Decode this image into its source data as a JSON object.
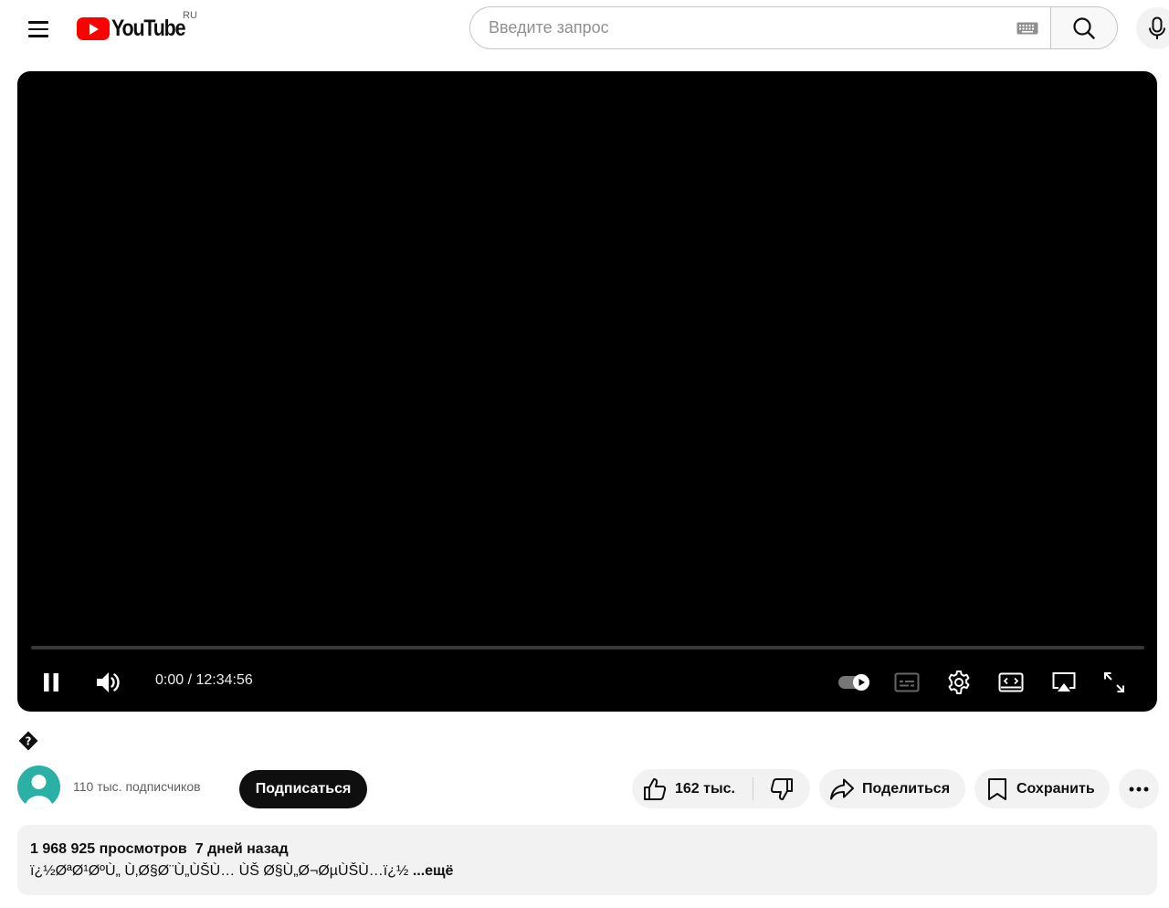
{
  "header": {
    "logo_text": "YouTube",
    "region": "RU",
    "search_placeholder": "Введите запрос",
    "search_value": ""
  },
  "player": {
    "current_time": "0:00",
    "separator": " / ",
    "duration": "12:34:56",
    "progress_fraction": 0,
    "autoplay_on": true
  },
  "channel": {
    "subscribers": "110 тыс. подписчиков",
    "subscribe_label": "Подписаться"
  },
  "actions": {
    "like_count": "162 тыс.",
    "share_label": "Поделиться",
    "save_label": "Сохранить"
  },
  "description": {
    "views": "1 968 925 просмотров",
    "date": "7 дней назад",
    "text": "ï¿½ØªØ¹ØºÙ„ Ù‚Ø§Ø¨Ù„ÙŠÙ… ÙŠ Ø§Ù„Ø¬ØµÙŠÙ…ï¿½",
    "more_label": "...ещё"
  },
  "colors": {
    "brand_red": "#ff0000",
    "text_primary": "#0f0f0f",
    "text_secondary": "#606060",
    "pill_bg": "#f2f2f2",
    "avatar_bg": "#2bb0a6"
  }
}
